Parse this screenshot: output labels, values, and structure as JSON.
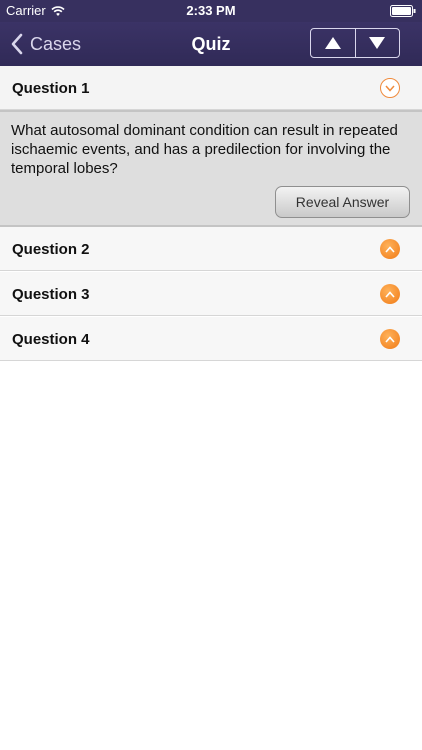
{
  "status_bar": {
    "carrier": "Carrier",
    "time": "2:33 PM",
    "wifi_icon": "wifi-icon",
    "battery_icon": "battery-icon"
  },
  "nav": {
    "back_label": "Cases",
    "title": "Quiz",
    "up_icon": "up-arrow-icon",
    "down_icon": "down-arrow-icon"
  },
  "questions": [
    {
      "label": "Question 1",
      "expanded": true,
      "text": "What autosomal dominant condition can result in repeated ischaemic events, and has a predilection for involving the temporal lobes?",
      "reveal_label": "Reveal Answer"
    },
    {
      "label": "Question 2",
      "expanded": false
    },
    {
      "label": "Question 3",
      "expanded": false
    },
    {
      "label": "Question 4",
      "expanded": false
    }
  ],
  "colors": {
    "nav_bg": "#37305f",
    "accent_orange": "#f07a16"
  }
}
